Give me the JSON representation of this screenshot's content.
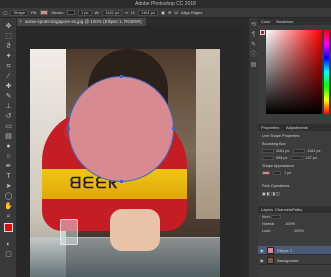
{
  "app": {
    "title": "Adobe Photoshop CC 2018"
  },
  "options_bar": {
    "mode": "Shape",
    "fill_label": "Fill:",
    "fill_color": "#d78a8f",
    "stroke_label": "Stroke:",
    "stroke_width": "1 px",
    "width_label": "W:",
    "width_value": "1161 px",
    "height_label": "H:",
    "height_value": "1161 px",
    "align_edges": "Align Edges"
  },
  "document": {
    "tab_title": "annie-spratt-singapore-ss.jpg @ 100% (Ellipse 1, RGB/8#)",
    "ellipse_color": "#d78a8f",
    "path_color": "#3a68c8"
  },
  "colors": {
    "foreground": "#df0a0a",
    "background": "#f2f2f2"
  },
  "panels": {
    "color_tabs": [
      "Color",
      "Swatches"
    ],
    "properties_tabs": [
      "Properties",
      "Adjustments"
    ],
    "live_shape_title": "Live Shape Properties",
    "bounding_box": "Bounding Box",
    "w_value": "1161 px",
    "h_value": "1161 px",
    "x_value": "396 px",
    "y_value": "137 px",
    "shape_appearance": "Shape Appearance",
    "stroke_size": "1 px",
    "path_operations": "Path Operations",
    "layers_tabs": [
      "Layers",
      "Channels",
      "Paths"
    ],
    "kind_label": "Kind",
    "blend_mode": "Normal",
    "opacity": "100%",
    "fill": "100%",
    "lock_label": "Lock:"
  },
  "layers": [
    {
      "name": "Ellipse 1",
      "active": true
    },
    {
      "name": "Background",
      "active": false
    }
  ],
  "icons": {
    "move": "move-icon",
    "marquee": "marquee-icon",
    "lasso": "lasso-icon",
    "crop": "crop-icon",
    "brush": "brush-icon",
    "eraser": "eraser-icon",
    "pen": "pen-icon",
    "text": "text-icon",
    "shape": "shape-icon",
    "hand": "hand-icon",
    "zoom": "zoom-icon"
  }
}
